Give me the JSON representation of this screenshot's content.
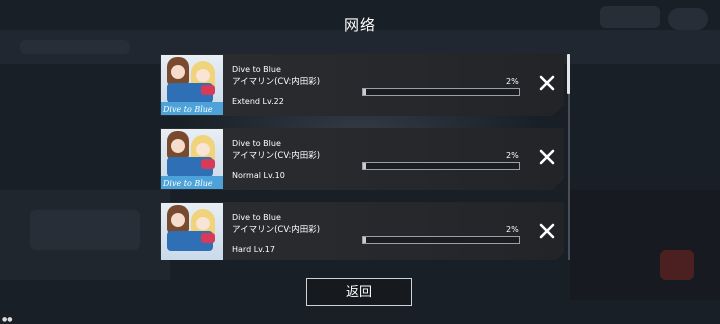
{
  "header": {
    "title": "网络"
  },
  "downloads": [
    {
      "song": "Dive to Blue",
      "artist": "アイマリン(CV:内田彩)",
      "difficulty": "Extend Lv.22",
      "progress_text": "2%",
      "progress": 0.02,
      "jacket_text": "Dive to Blue"
    },
    {
      "song": "Dive to Blue",
      "artist": "アイマリン(CV:内田彩)",
      "difficulty": "Normal Lv.10",
      "progress_text": "2%",
      "progress": 0.02,
      "jacket_text": "Dive to Blue"
    },
    {
      "song": "Dive to Blue",
      "artist": "アイマリン(CV:内田彩)",
      "difficulty": "Hard Lv.17",
      "progress_text": "2%",
      "progress": 0.02,
      "jacket_text": ""
    }
  ],
  "footer": {
    "back_label": "返回"
  },
  "icons": {
    "cancel": "close-icon"
  }
}
